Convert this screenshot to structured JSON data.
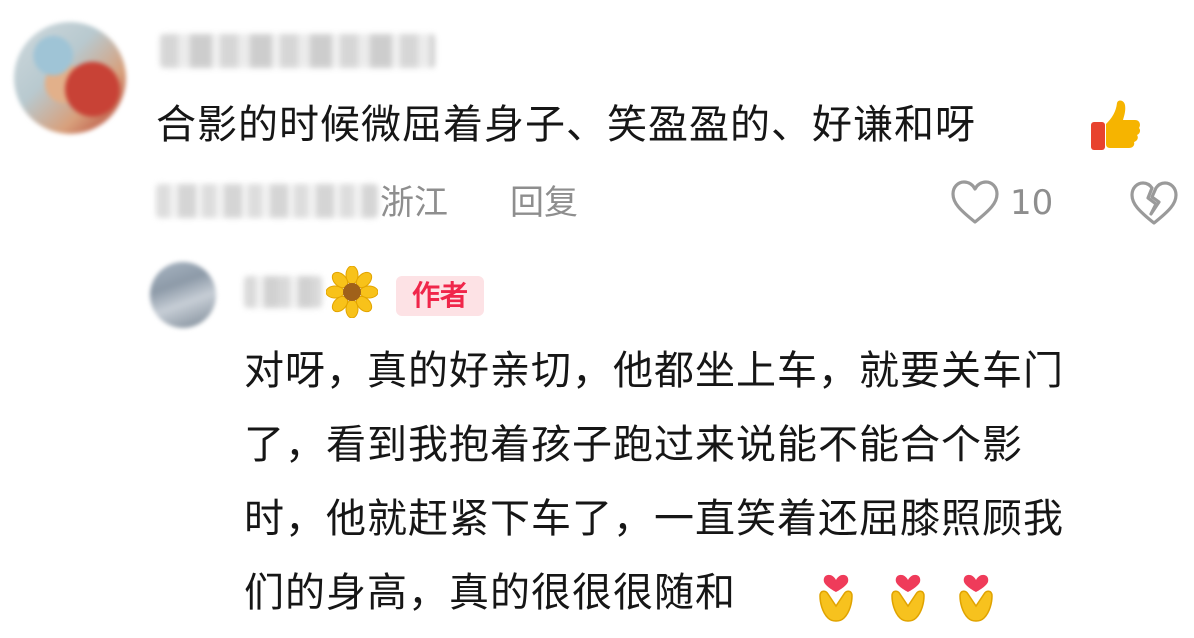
{
  "comment": {
    "text": "合影的时候微屈着身子、笑盈盈的、好谦和呀",
    "emoji": "thumbs-up-emoji",
    "location": "浙江",
    "reply_label": "回复",
    "like_count": "10"
  },
  "reply": {
    "author_badge": "作者",
    "name_emoji": "sunflower-emoji",
    "lines": [
      "对呀，真的好亲切，他都坐上车，就要关车门",
      "了，看到我抱着孩子跑过来说能不能合个影",
      "时，他就赶紧下车了，一直笑着还屈膝照顾我",
      "们的身高，真的很很很随和"
    ],
    "trailing_emoji": "heart-hands-emoji"
  },
  "colors": {
    "text": "#161616",
    "meta": "#8e8e8e",
    "badge_bg": "#fde2e5",
    "badge_text": "#f0264a"
  }
}
